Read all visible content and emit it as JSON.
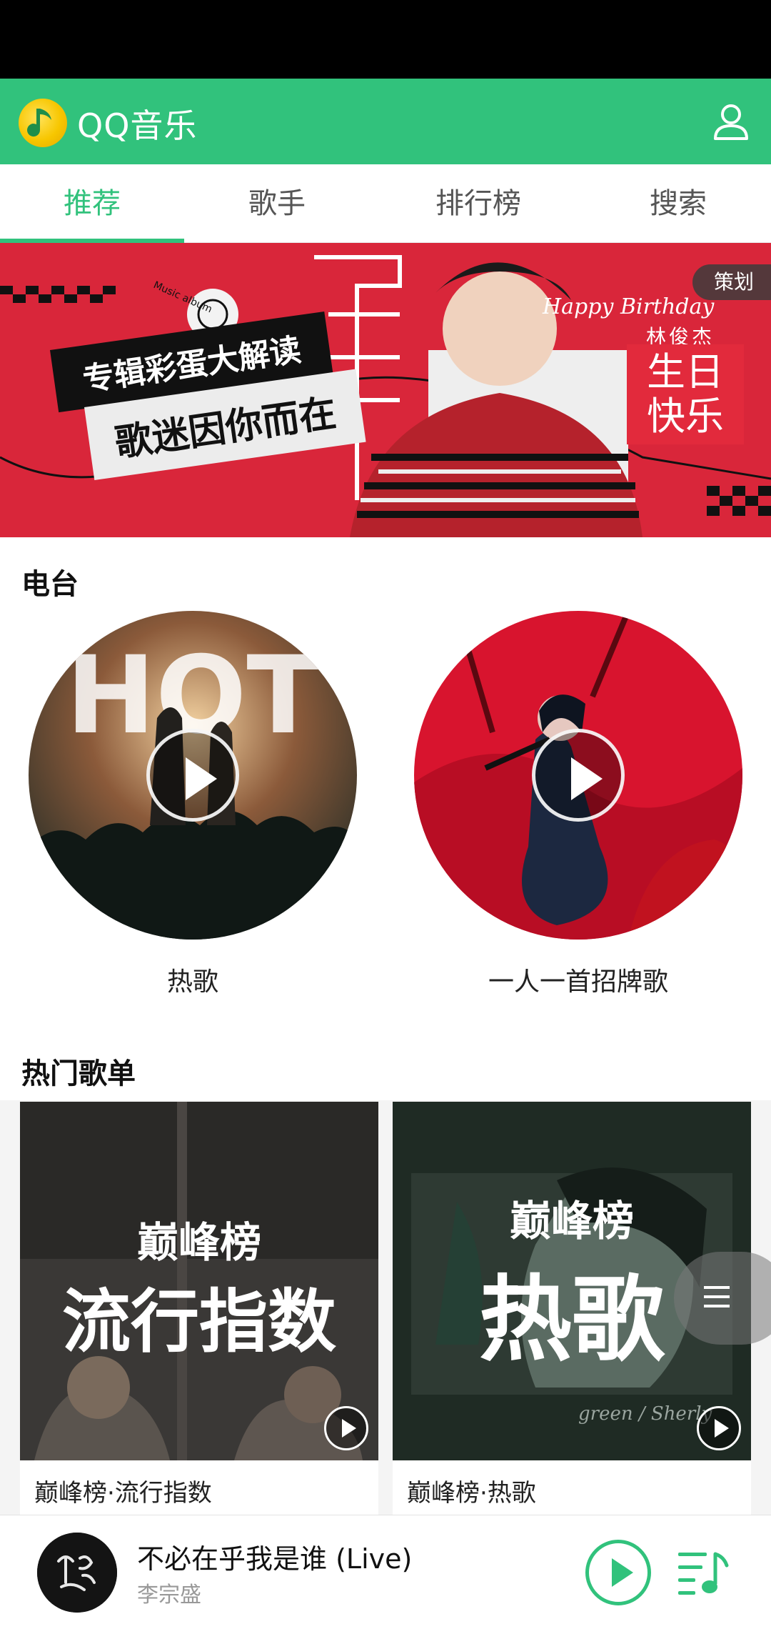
{
  "app": {
    "title": "QQ音乐"
  },
  "colors": {
    "brand": "#31c27c",
    "banner_red": "#d9263a"
  },
  "icons": {
    "logo": "qq-music-logo-icon",
    "user": "user-icon",
    "menu": "menu-icon",
    "playlist": "playlist-icon",
    "play": "play-icon"
  },
  "tabs": [
    {
      "label": "推荐",
      "active": true
    },
    {
      "label": "歌手",
      "active": false
    },
    {
      "label": "排行榜",
      "active": false
    },
    {
      "label": "搜索",
      "active": false
    }
  ],
  "banner": {
    "badge": "策划",
    "line1": "专辑彩蛋大解读",
    "line2": "歌迷因你而在",
    "script_text": "Happy Birthday",
    "artist": "林俊杰",
    "greeting_line1": "生日",
    "greeting_line2": "快乐",
    "small_caption": "Music album"
  },
  "radio": {
    "title": "电台",
    "items": [
      {
        "label": "热歌",
        "cover_text": "HOT"
      },
      {
        "label": "一人一首招牌歌"
      }
    ]
  },
  "playlists": {
    "title": "热门歌单",
    "items": [
      {
        "title": "巅峰榜·流行指数",
        "cover_brand": "巅峰榜",
        "cover_big": "流行指数"
      },
      {
        "title": "巅峰榜·热歌",
        "cover_brand": "巅峰榜",
        "cover_big": "热歌",
        "cover_caption": "green / Sherly"
      }
    ]
  },
  "player": {
    "song": "不必在乎我是谁 (Live)",
    "artist": "李宗盛"
  }
}
